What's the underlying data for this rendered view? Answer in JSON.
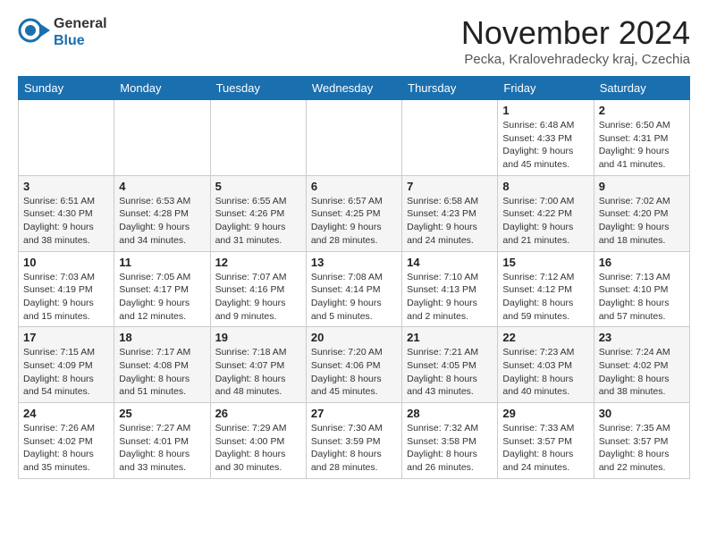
{
  "logo": {
    "line1": "General",
    "line2": "Blue"
  },
  "title": "November 2024",
  "subtitle": "Pecka, Kralovehradecky kraj, Czechia",
  "days_header": [
    "Sunday",
    "Monday",
    "Tuesday",
    "Wednesday",
    "Thursday",
    "Friday",
    "Saturday"
  ],
  "weeks": [
    [
      {
        "day": "",
        "info": ""
      },
      {
        "day": "",
        "info": ""
      },
      {
        "day": "",
        "info": ""
      },
      {
        "day": "",
        "info": ""
      },
      {
        "day": "",
        "info": ""
      },
      {
        "day": "1",
        "info": "Sunrise: 6:48 AM\nSunset: 4:33 PM\nDaylight: 9 hours and 45 minutes."
      },
      {
        "day": "2",
        "info": "Sunrise: 6:50 AM\nSunset: 4:31 PM\nDaylight: 9 hours and 41 minutes."
      }
    ],
    [
      {
        "day": "3",
        "info": "Sunrise: 6:51 AM\nSunset: 4:30 PM\nDaylight: 9 hours and 38 minutes."
      },
      {
        "day": "4",
        "info": "Sunrise: 6:53 AM\nSunset: 4:28 PM\nDaylight: 9 hours and 34 minutes."
      },
      {
        "day": "5",
        "info": "Sunrise: 6:55 AM\nSunset: 4:26 PM\nDaylight: 9 hours and 31 minutes."
      },
      {
        "day": "6",
        "info": "Sunrise: 6:57 AM\nSunset: 4:25 PM\nDaylight: 9 hours and 28 minutes."
      },
      {
        "day": "7",
        "info": "Sunrise: 6:58 AM\nSunset: 4:23 PM\nDaylight: 9 hours and 24 minutes."
      },
      {
        "day": "8",
        "info": "Sunrise: 7:00 AM\nSunset: 4:22 PM\nDaylight: 9 hours and 21 minutes."
      },
      {
        "day": "9",
        "info": "Sunrise: 7:02 AM\nSunset: 4:20 PM\nDaylight: 9 hours and 18 minutes."
      }
    ],
    [
      {
        "day": "10",
        "info": "Sunrise: 7:03 AM\nSunset: 4:19 PM\nDaylight: 9 hours and 15 minutes."
      },
      {
        "day": "11",
        "info": "Sunrise: 7:05 AM\nSunset: 4:17 PM\nDaylight: 9 hours and 12 minutes."
      },
      {
        "day": "12",
        "info": "Sunrise: 7:07 AM\nSunset: 4:16 PM\nDaylight: 9 hours and 9 minutes."
      },
      {
        "day": "13",
        "info": "Sunrise: 7:08 AM\nSunset: 4:14 PM\nDaylight: 9 hours and 5 minutes."
      },
      {
        "day": "14",
        "info": "Sunrise: 7:10 AM\nSunset: 4:13 PM\nDaylight: 9 hours and 2 minutes."
      },
      {
        "day": "15",
        "info": "Sunrise: 7:12 AM\nSunset: 4:12 PM\nDaylight: 8 hours and 59 minutes."
      },
      {
        "day": "16",
        "info": "Sunrise: 7:13 AM\nSunset: 4:10 PM\nDaylight: 8 hours and 57 minutes."
      }
    ],
    [
      {
        "day": "17",
        "info": "Sunrise: 7:15 AM\nSunset: 4:09 PM\nDaylight: 8 hours and 54 minutes."
      },
      {
        "day": "18",
        "info": "Sunrise: 7:17 AM\nSunset: 4:08 PM\nDaylight: 8 hours and 51 minutes."
      },
      {
        "day": "19",
        "info": "Sunrise: 7:18 AM\nSunset: 4:07 PM\nDaylight: 8 hours and 48 minutes."
      },
      {
        "day": "20",
        "info": "Sunrise: 7:20 AM\nSunset: 4:06 PM\nDaylight: 8 hours and 45 minutes."
      },
      {
        "day": "21",
        "info": "Sunrise: 7:21 AM\nSunset: 4:05 PM\nDaylight: 8 hours and 43 minutes."
      },
      {
        "day": "22",
        "info": "Sunrise: 7:23 AM\nSunset: 4:03 PM\nDaylight: 8 hours and 40 minutes."
      },
      {
        "day": "23",
        "info": "Sunrise: 7:24 AM\nSunset: 4:02 PM\nDaylight: 8 hours and 38 minutes."
      }
    ],
    [
      {
        "day": "24",
        "info": "Sunrise: 7:26 AM\nSunset: 4:02 PM\nDaylight: 8 hours and 35 minutes."
      },
      {
        "day": "25",
        "info": "Sunrise: 7:27 AM\nSunset: 4:01 PM\nDaylight: 8 hours and 33 minutes."
      },
      {
        "day": "26",
        "info": "Sunrise: 7:29 AM\nSunset: 4:00 PM\nDaylight: 8 hours and 30 minutes."
      },
      {
        "day": "27",
        "info": "Sunrise: 7:30 AM\nSunset: 3:59 PM\nDaylight: 8 hours and 28 minutes."
      },
      {
        "day": "28",
        "info": "Sunrise: 7:32 AM\nSunset: 3:58 PM\nDaylight: 8 hours and 26 minutes."
      },
      {
        "day": "29",
        "info": "Sunrise: 7:33 AM\nSunset: 3:57 PM\nDaylight: 8 hours and 24 minutes."
      },
      {
        "day": "30",
        "info": "Sunrise: 7:35 AM\nSunset: 3:57 PM\nDaylight: 8 hours and 22 minutes."
      }
    ]
  ]
}
